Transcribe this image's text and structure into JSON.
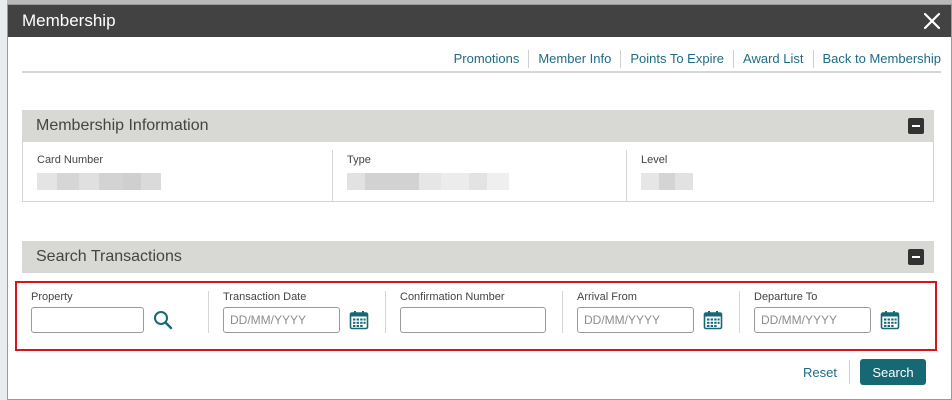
{
  "dialog": {
    "title": "Membership",
    "close_icon": "close-icon"
  },
  "nav_links": [
    {
      "label": "Promotions"
    },
    {
      "label": "Member Info"
    },
    {
      "label": "Points To Expire"
    },
    {
      "label": "Award List"
    },
    {
      "label": "Back to Membership"
    }
  ],
  "membership_info": {
    "title": "Membership Information",
    "collapse_icon": "minus-icon",
    "fields": [
      {
        "label": "Card Number"
      },
      {
        "label": "Type"
      },
      {
        "label": "Level"
      }
    ]
  },
  "search_transactions": {
    "title": "Search Transactions",
    "collapse_icon": "minus-icon",
    "fields": {
      "property": {
        "label": "Property",
        "value": "",
        "icon": "search-icon"
      },
      "transaction_date": {
        "label": "Transaction Date",
        "placeholder": "DD/MM/YYYY",
        "icon": "calendar-icon"
      },
      "confirmation_number": {
        "label": "Confirmation Number",
        "value": ""
      },
      "arrival_from": {
        "label": "Arrival From",
        "placeholder": "DD/MM/YYYY",
        "icon": "calendar-icon"
      },
      "departure_to": {
        "label": "Departure To",
        "placeholder": "DD/MM/YYYY",
        "icon": "calendar-icon"
      }
    }
  },
  "actions": {
    "reset_label": "Reset",
    "search_label": "Search"
  },
  "colors": {
    "titlebar": "#424242",
    "link": "#1f6b82",
    "primary_button": "#176875",
    "highlight_border": "#d9141e",
    "icon_accent": "#176875"
  }
}
